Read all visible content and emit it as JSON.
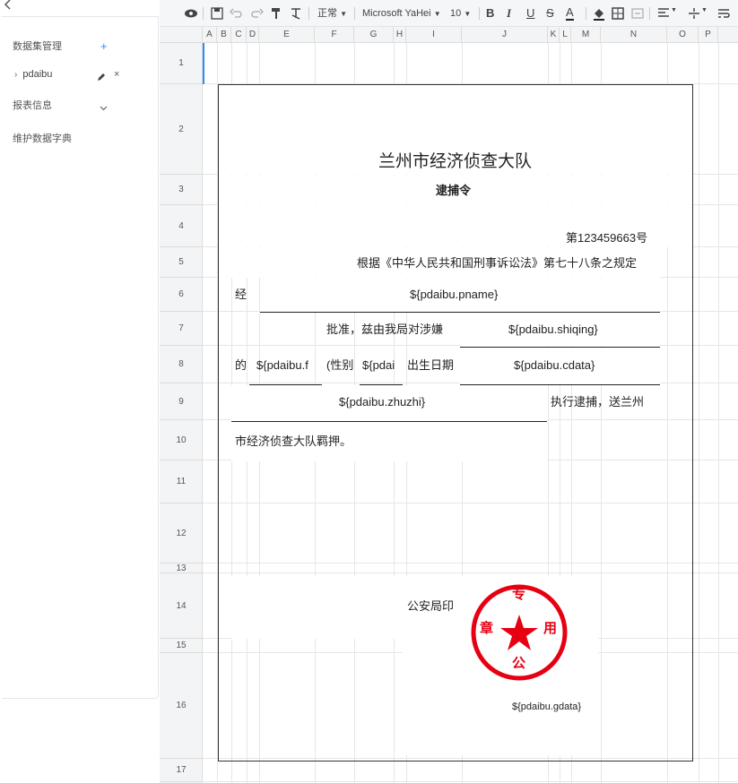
{
  "sidebar": {
    "collapse_icon": "chevron-left-icon",
    "dataset_title": "数据集管理",
    "dataset_name": "pdaibu",
    "report_info": "报表信息",
    "dict_label": "维护数据字典"
  },
  "toolbar": {
    "style_select": "正常",
    "font_select": "Microsoft YaHei",
    "size_select": "10",
    "icons": [
      "preview-icon",
      "save-icon",
      "undo-icon",
      "redo-icon",
      "format-painter-icon",
      "clear-format-icon",
      "bold-icon",
      "italic-icon",
      "underline-icon",
      "strikethrough-icon",
      "font-color-icon",
      "fill-color-icon",
      "border-icon",
      "merge-icon",
      "align-icon",
      "valign-icon",
      "wrap-icon"
    ]
  },
  "columns": [
    "A",
    "B",
    "C",
    "D",
    "E",
    "F",
    "G",
    "H",
    "I",
    "J",
    "K",
    "L",
    "M",
    "N",
    "O",
    "P"
  ],
  "rows": [
    "1",
    "2",
    "3",
    "4",
    "5",
    "6",
    "7",
    "8",
    "9",
    "10",
    "11",
    "12",
    "13",
    "14",
    "15",
    "16",
    "17"
  ],
  "document": {
    "org_title": "兰州市经济侦查大队",
    "doc_title": "逮捕令",
    "doc_no": "第123459663号",
    "basis": "根据《中华人民共和国刑事诉讼法》第七十八条之规定",
    "jing": "经",
    "pname": "${pdaibu.pname}",
    "approve": "批准，兹由我局对涉嫌",
    "shiqing": "${pdaibu.shiqing}",
    "de": "的",
    "field_f": "${pdaibu.f",
    "xingbie": "(性别",
    "field_pdai": "${pdai",
    "birth_label": "出生日期",
    "cdata": "${pdaibu.cdata}",
    "zhuzhi": "${pdaibu.zhuzhi}",
    "execute": "执行逮捕，送兰州",
    "detain": "市经济侦查大队羁押。",
    "seal_label": "公安局印",
    "gdata": "${pdaibu.gdata}",
    "seal_chars": [
      "专",
      "用",
      "章",
      "公"
    ]
  }
}
